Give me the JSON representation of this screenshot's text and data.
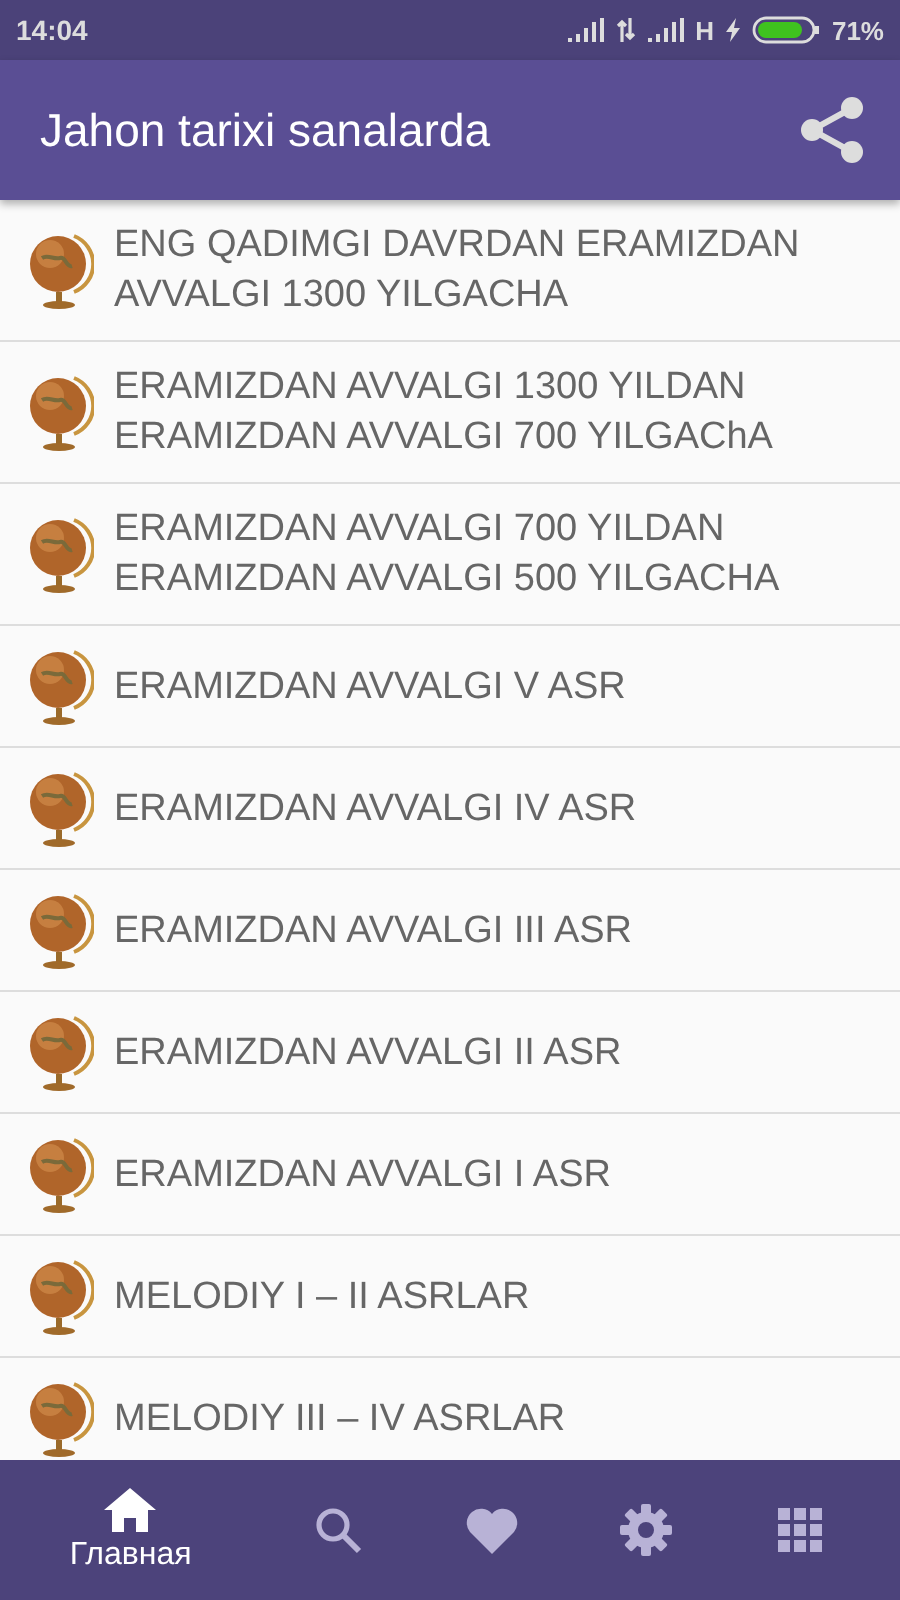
{
  "status_bar": {
    "time": "14:04",
    "network": "H",
    "battery": "71%"
  },
  "app_bar": {
    "title": "Jahon tarixi sanalarda"
  },
  "list": [
    {
      "text": "ENG QADIMGI DAVRDAN ERAMIZDAN\nAVVALGI 1300 YILGACHA"
    },
    {
      "text": "ERAMIZDAN AVVALGI 1300 YILDAN\nERAMIZDAN AVVALGI 700 YILGAChA"
    },
    {
      "text": "ERAMIZDAN AVVALGI 700 YILDAN\nERAMIZDAN AVVALGI 500 YILGACHA"
    },
    {
      "text": "ERAMIZDAN AVVALGI V ASR"
    },
    {
      "text": "ERAMIZDAN AVVALGI IV ASR"
    },
    {
      "text": "ERAMIZDAN AVVALGI III ASR"
    },
    {
      "text": "ERAMIZDAN AVVALGI II ASR"
    },
    {
      "text": "ERAMIZDAN AVVALGI I ASR"
    },
    {
      "text": "MELODIY I – II ASRLAR"
    },
    {
      "text": "MELODIY III – IV ASRLAR"
    }
  ],
  "bottom_nav": [
    {
      "kind": "home",
      "label": "Главная",
      "selected": true
    },
    {
      "kind": "search",
      "selected": false
    },
    {
      "kind": "heart",
      "selected": false
    },
    {
      "kind": "settings",
      "selected": false
    },
    {
      "kind": "grid",
      "selected": false
    }
  ]
}
